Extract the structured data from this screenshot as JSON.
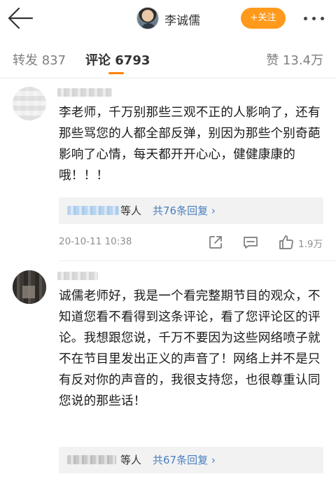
{
  "header": {
    "user_name": "李诚儒",
    "follow_label": "+关注"
  },
  "tabs": {
    "repost_label": "转发 837",
    "comments_label": "评论 6793",
    "likes_label": "赞 13.4万"
  },
  "comments": [
    {
      "text": "李老师，千万别那些三观不正的人影响了，还有那些骂您的人都全部反弹，别因为那些个别奇葩影响了心情，每天都开开心心，健健康康的哦！！！",
      "reply_etc": "等人",
      "reply_count": "共76条回复 ›",
      "time": "20-10-11 10:38",
      "likes": "1.9万"
    },
    {
      "text": "诚儒老师好，我是一个看完整期节目的观众，不知道您看不看得到这条评论，看了您评论区的评论。我想跟您说，千万不要因为这些网络喷子就不在节目里发出正义的声音了！网络上并不是只有反对你的声音的，我很支持您，也很尊重认同您说的那些话！",
      "reply_etc": "等人",
      "reply_count": "共67条回复 ›"
    }
  ],
  "colors": {
    "accent_orange": "#ff9a1c",
    "tab_underline": "#ff8200",
    "link_blue": "#4a7fbd"
  },
  "icons": {
    "back": "back-arrow-icon",
    "more": "more-dots-icon",
    "share": "share-icon",
    "comment": "comment-icon",
    "like": "thumbs-up-icon"
  }
}
